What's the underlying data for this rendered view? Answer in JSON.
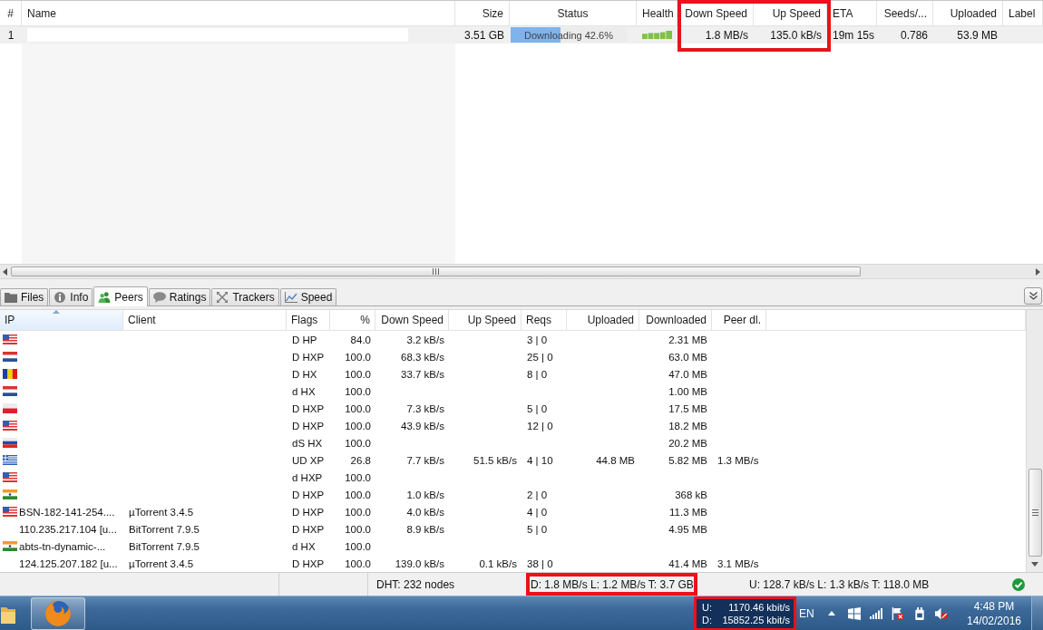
{
  "torrent_list": {
    "columns": [
      {
        "label": "#",
        "highlighted": false
      },
      {
        "label": "Name",
        "highlighted": false
      },
      {
        "label": "Size",
        "highlighted": false
      },
      {
        "label": "Status",
        "highlighted": false
      },
      {
        "label": "Health",
        "highlighted": false
      },
      {
        "label": "Down Speed",
        "highlighted": true
      },
      {
        "label": "Up Speed",
        "highlighted": true
      },
      {
        "label": "ETA",
        "highlighted": false
      },
      {
        "label": "Seeds/...",
        "highlighted": false
      },
      {
        "label": "Uploaded",
        "highlighted": false
      },
      {
        "label": "Label",
        "highlighted": false
      }
    ],
    "rows": [
      {
        "selected": true,
        "number": "1",
        "size": "3.51 GB",
        "status": {
          "text": "Downloading 42.6%",
          "level": 0.426
        },
        "down_speed": "1.8 MB/s",
        "up_speed": "135.0 kB/s",
        "eta": "19m 15s",
        "seeds_peers": "0.786",
        "uploaded": "53.9 MB"
      }
    ]
  },
  "detail_tabs": [
    {
      "label": "Files",
      "selected": false
    },
    {
      "label": "Info",
      "selected": false
    },
    {
      "label": "Peers",
      "selected": true
    },
    {
      "label": "Ratings",
      "selected": false
    },
    {
      "label": "Trackers",
      "selected": false
    },
    {
      "label": "Speed",
      "selected": false
    }
  ],
  "peers": {
    "columns": [
      {
        "label": "IP",
        "sorted": true
      },
      {
        "label": "Client",
        "sorted": false
      },
      {
        "label": "Flags",
        "sorted": false
      },
      {
        "label": "%",
        "sorted": false
      },
      {
        "label": "Down Speed",
        "sorted": false
      },
      {
        "label": "Up Speed",
        "sorted": false
      },
      {
        "label": "Reqs",
        "sorted": false
      },
      {
        "label": "Uploaded",
        "sorted": false
      },
      {
        "label": "Downloaded",
        "sorted": false
      },
      {
        "label": "Peer dl.",
        "sorted": false
      }
    ],
    "rows": [
      {
        "kind": "us",
        "flags": "D HP",
        "percent": "84.0",
        "down_speed": "3.2 kB/s",
        "reqs": "3 | 0",
        "downloaded": "2.31 MB"
      },
      {
        "kind": "nl",
        "flags": "D HXP",
        "percent": "100.0",
        "down_speed": "68.3 kB/s",
        "reqs": "25 | 0",
        "downloaded": "63.0 MB"
      },
      {
        "kind": "ro",
        "flags": "D HX",
        "percent": "100.0",
        "down_speed": "33.7 kB/s",
        "reqs": "8 | 0",
        "downloaded": "47.0 MB"
      },
      {
        "kind": "nl",
        "flags": "d HX",
        "percent": "100.0",
        "downloaded": "1.00 MB"
      },
      {
        "kind": "pl",
        "flags": "D HXP",
        "percent": "100.0",
        "down_speed": "7.3 kB/s",
        "reqs": "5 | 0",
        "downloaded": "17.5 MB"
      },
      {
        "kind": "us",
        "flags": "D HXP",
        "percent": "100.0",
        "down_speed": "43.9 kB/s",
        "reqs": "12 | 0",
        "downloaded": "18.2 MB"
      },
      {
        "kind": "ru",
        "flags": "dS HX",
        "percent": "100.0",
        "downloaded": "20.2 MB"
      },
      {
        "kind": "gr",
        "flags": "UD XP",
        "percent": "26.8",
        "down_speed": "7.7 kB/s",
        "up_speed": "51.5 kB/s",
        "reqs": "4 | 10",
        "uploaded": "44.8 MB",
        "downloaded": "5.82 MB",
        "peer_dl": "1.3 MB/s"
      },
      {
        "kind": "us",
        "flags": "d HXP",
        "percent": "100.0"
      },
      {
        "kind": "in",
        "flags": "D HXP",
        "percent": "100.0",
        "down_speed": "1.0 kB/s",
        "reqs": "2 | 0",
        "downloaded": "368 kB"
      },
      {
        "kind": "us",
        "ip": "BSN-182-141-254....",
        "client": "µTorrent 3.4.5",
        "flags": "D HXP",
        "percent": "100.0",
        "down_speed": "4.0 kB/s",
        "reqs": "4 | 0",
        "downloaded": "11.3 MB"
      },
      {
        "kind": "none",
        "ip": "110.235.217.104 [u...",
        "client": "BitTorrent 7.9.5",
        "flags": "D HXP",
        "percent": "100.0",
        "down_speed": "8.9 kB/s",
        "reqs": "5 | 0",
        "downloaded": "4.95 MB"
      },
      {
        "kind": "in",
        "ip": "abts-tn-dynamic-...",
        "client": "BitTorrent 7.9.5",
        "flags": "d HX",
        "percent": "100.0"
      },
      {
        "kind": "none",
        "ip": "124.125.207.182 [u...",
        "client": "µTorrent 3.4.5",
        "flags": "D HXP",
        "percent": "100.0",
        "down_speed": "139.0 kB/s",
        "up_speed": "0.1 kB/s",
        "reqs": "38 | 0",
        "downloaded": "41.4 MB",
        "peer_dl": "3.1 MB/s"
      }
    ]
  },
  "status_bar": {
    "segments": [
      {
        "text": "DHT: 232 nodes",
        "highlighted": false
      },
      {
        "text": "D: 1.8 MB/s L: 1.2 MB/s T: 3.7 GB",
        "highlighted": true
      },
      {
        "text": "U: 128.7 kB/s L: 1.3 kB/s T: 118.0 MB",
        "highlighted": false
      }
    ]
  },
  "taskbar": {
    "net_meter": {
      "highlighted": true,
      "lines": [
        {
          "label": "U:",
          "value": "1170.46 kbit/s"
        },
        {
          "label": "D:",
          "value": "15852.25 kbit/s"
        }
      ]
    },
    "language": "EN",
    "clock": {
      "time": "4:48 PM",
      "date": "14/02/2016"
    }
  }
}
